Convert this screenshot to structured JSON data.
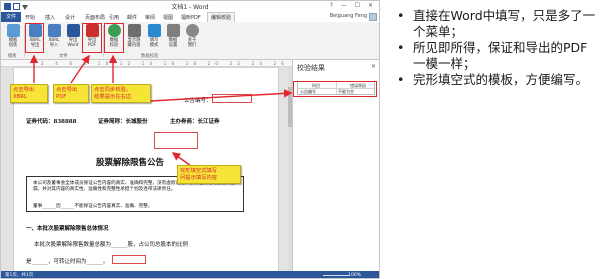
{
  "window": {
    "title": "文档1 - Word",
    "user": "Beiguang Feng",
    "controls": "?  —  ☐  ✕"
  },
  "tabs": [
    "文件",
    "开始",
    "插入",
    "设计",
    "页面布局",
    "引用",
    "邮件",
    "审阅",
    "视图",
    "福昕PDF",
    "编辑校验"
  ],
  "ribbon": {
    "buttons": [
      {
        "label": "模板\n组装",
        "icon": "template-icon",
        "color": "#5b9bd5"
      },
      {
        "label": "XBRL\n导出",
        "icon": "xbrl-export-icon",
        "color": "#4a7fc0"
      },
      {
        "label": "XBRL\n导入",
        "icon": "xbrl-import-icon",
        "color": "#4a7fc0"
      },
      {
        "label": "导出\nWord",
        "icon": "word-export-icon",
        "color": "#2b579a"
      },
      {
        "label": "导出\nPDF",
        "icon": "pdf-export-icon",
        "color": "#c9302c"
      },
      {
        "label": "数据\n校验",
        "icon": "validate-icon",
        "color": "#3c9b54"
      },
      {
        "label": "显示隐\n藏内容",
        "icon": "show-hide-icon",
        "color": "#6d6d6d"
      },
      {
        "label": "填写\n模式",
        "icon": "fill-mode-icon",
        "color": "#2b89d0"
      },
      {
        "label": "数据\n设置",
        "icon": "data-settings-icon",
        "color": "#7f7f7f"
      },
      {
        "label": "关于\n我们",
        "icon": "about-icon",
        "color": "#888888"
      }
    ],
    "groups": [
      "模板",
      "文件",
      "数据校验"
    ]
  },
  "ruler_text": "2 4 6 8 10 12 14 16 18 20 22 24 26 28 30 32 34 36 38 40",
  "document": {
    "announcement_no_label": "公告编号：",
    "securities_code": "证券代码：838888",
    "securities_abbr": "证券简称：长城股份",
    "sponsor": "主办券商：长江证券",
    "heading": "股票解除限售公告",
    "body_line1": "本公司及董事会全体成员保证公告内容的真实、准确和完整，没有虚假记载、误导性陈述或者重大遗漏，并对其内容的真实性、准确性和完整性承担个别及连带法律责任。",
    "body_line2": "董事______因______不能保证公告内容真实、准确、完整。",
    "section1": "一、本批次股票解除限售总体情况",
    "para1": "本批次股票解除限售数量总额为______股，占公司总股本的比例",
    "para2": "是______，可转让时间为______。"
  },
  "pane": {
    "title": "校验结果",
    "col1": "科目",
    "col2": "错误原因",
    "row_subject": "公告编号",
    "row_reason": "不能为空"
  },
  "status": {
    "left": "第1页，共1页",
    "zoom": "100%"
  },
  "callouts": {
    "xbrl": "点击导出\nXBRL",
    "pdf": "点击导出\nPDF",
    "validate": "点击同步校验，\n结果提示在右边",
    "fill": "完形填空式填写\n问提示填写内容"
  },
  "bullets": [
    "直接在Word中填写，只是多了一个菜单；",
    "所见即所得，保证和导出的PDF一模一样；",
    "完形填空式的模板，方便编写。"
  ]
}
